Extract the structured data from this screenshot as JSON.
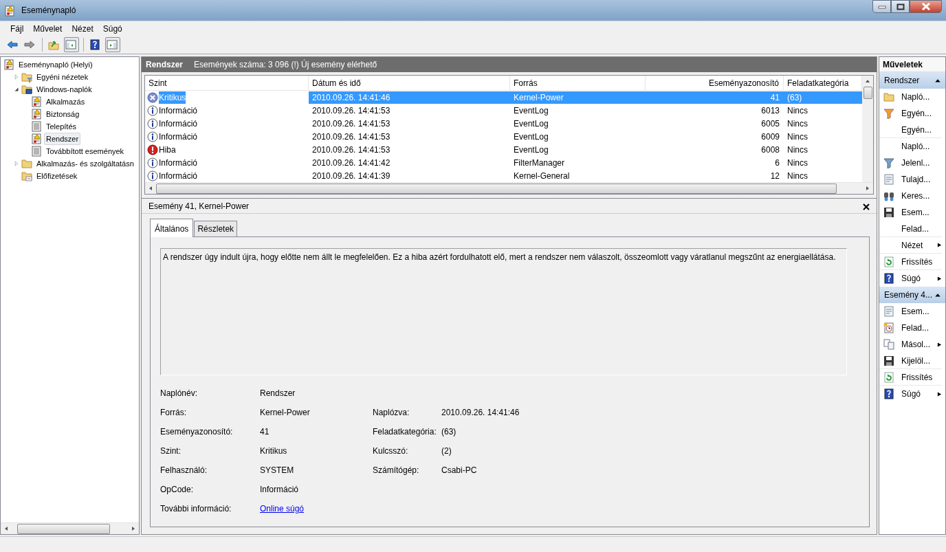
{
  "window": {
    "title": "Eseménynapló"
  },
  "menu": [
    "Fájl",
    "Művelet",
    "Nézet",
    "Súgó"
  ],
  "toolbar": [
    {
      "kind": "back",
      "pressed": false
    },
    {
      "kind": "forward",
      "pressed": false
    },
    {
      "kind": "sep"
    },
    {
      "kind": "up",
      "pressed": false
    },
    {
      "kind": "tree",
      "pressed": true
    },
    {
      "kind": "sep"
    },
    {
      "kind": "help",
      "pressed": false
    },
    {
      "kind": "actions",
      "pressed": true
    }
  ],
  "tree": [
    {
      "label": "Eseménynapló (Helyi)",
      "kind": "log",
      "selected": false,
      "children": [
        {
          "label": "Egyéni nézetek",
          "kind": "folder-filter",
          "expanded": false,
          "selected": false
        },
        {
          "label": "Windows-naplók",
          "kind": "folder-computer",
          "expanded": true,
          "selected": false,
          "children": [
            {
              "label": "Alkalmazás",
              "kind": "log",
              "selected": false
            },
            {
              "label": "Biztonság",
              "kind": "log",
              "selected": false
            },
            {
              "label": "Telepítés",
              "kind": "log-plain",
              "selected": false
            },
            {
              "label": "Rendszer",
              "kind": "log",
              "selected": true
            },
            {
              "label": "Továbbított események",
              "kind": "log-plain",
              "selected": false
            }
          ]
        },
        {
          "label": "Alkalmazás- és szolgáltatásn",
          "kind": "folder",
          "expanded": false,
          "selected": false
        },
        {
          "label": "Előfizetések",
          "kind": "folder-sub",
          "selected": false
        }
      ]
    }
  ],
  "list_header": {
    "title": "Rendszer",
    "info": "Események száma: 3 096 (!) Új esemény elérhető"
  },
  "table": {
    "columns": [
      "Szint",
      "Dátum és idő",
      "Forrás",
      "Eseményazonosító",
      "Feladatkategória"
    ],
    "rows": [
      {
        "kind": "critical",
        "level": "Kritikus",
        "date": "2010.09.26. 14:41:46",
        "source": "Kernel-Power",
        "id": "41",
        "category": "(63)",
        "selected": true
      },
      {
        "kind": "info",
        "level": "Információ",
        "date": "2010.09.26. 14:41:53",
        "source": "EventLog",
        "id": "6013",
        "category": "Nincs",
        "selected": false
      },
      {
        "kind": "info",
        "level": "Információ",
        "date": "2010.09.26. 14:41:53",
        "source": "EventLog",
        "id": "6005",
        "category": "Nincs",
        "selected": false
      },
      {
        "kind": "info",
        "level": "Információ",
        "date": "2010.09.26. 14:41:53",
        "source": "EventLog",
        "id": "6009",
        "category": "Nincs",
        "selected": false
      },
      {
        "kind": "error",
        "level": "Hiba",
        "date": "2010.09.26. 14:41:53",
        "source": "EventLog",
        "id": "6008",
        "category": "Nincs",
        "selected": false
      },
      {
        "kind": "info",
        "level": "Információ",
        "date": "2010.09.26. 14:41:42",
        "source": "FilterManager",
        "id": "6",
        "category": "Nincs",
        "selected": false
      },
      {
        "kind": "info",
        "level": "Információ",
        "date": "2010.09.26. 14:41:39",
        "source": "Kernel-General",
        "id": "12",
        "category": "Nincs",
        "selected": false
      }
    ]
  },
  "details": {
    "title": "Esemény 41, Kernel-Power",
    "tabs": [
      {
        "label": "Általános",
        "selected": true
      },
      {
        "label": "Részletek",
        "selected": false
      }
    ],
    "description": "A rendszer úgy indult újra, hogy előtte nem állt le megfelelően. Ez a hiba azért fordulhatott elő, mert a rendszer nem válaszolt, összeomlott vagy váratlanul megszűnt az energiaellátása.",
    "fields": [
      [
        {
          "label": "Naplónév:",
          "value": "Rendszer"
        }
      ],
      [
        {
          "label": "Forrás:",
          "value": "Kernel-Power"
        },
        {
          "label": "Naplózva:",
          "value": "2010.09.26. 14:41:46"
        }
      ],
      [
        {
          "label": "Eseményazonosító:",
          "value": "41"
        },
        {
          "label": "Feladatkategória:",
          "value": "(63)"
        }
      ],
      [
        {
          "label": "Szint:",
          "value": "Kritikus"
        },
        {
          "label": "Kulcsszó:",
          "value": "(2)"
        }
      ],
      [
        {
          "label": "Felhasználó:",
          "value": "SYSTEM"
        },
        {
          "label": "Számítógép:",
          "value": "Csabi-PC"
        }
      ],
      [
        {
          "label": "OpCode:",
          "value": "Információ"
        }
      ],
      [
        {
          "label": "További információ:",
          "value": "Online súgó",
          "kind": "link"
        }
      ]
    ]
  },
  "actions": {
    "title": "Műveletek",
    "sections": [
      {
        "title": "Rendszer",
        "expanded": true,
        "items": [
          {
            "label": "Napló...",
            "kind": "folder",
            "submenu": false,
            "separator_after": false
          },
          {
            "label": "Egyén...",
            "kind": "filter-gold",
            "submenu": false,
            "separator_after": false
          },
          {
            "label": "Egyén...",
            "kind": "none",
            "submenu": false,
            "separator_after": true
          },
          {
            "label": "Napló...",
            "kind": "none",
            "submenu": false,
            "separator_after": false
          },
          {
            "label": "Jelenl...",
            "kind": "filter",
            "submenu": false,
            "separator_after": false
          },
          {
            "label": "Tulajd...",
            "kind": "properties",
            "submenu": false,
            "separator_after": false
          },
          {
            "label": "Keres...",
            "kind": "binoculars",
            "submenu": false,
            "separator_after": false
          },
          {
            "label": "Esem...",
            "kind": "save",
            "submenu": false,
            "separator_after": false
          },
          {
            "label": "Felad...",
            "kind": "none",
            "submenu": false,
            "separator_after": true
          },
          {
            "label": "Nézet",
            "kind": "none",
            "submenu": true,
            "separator_after": true
          },
          {
            "label": "Frissítés",
            "kind": "refresh",
            "submenu": false,
            "separator_after": true
          },
          {
            "label": "Súgó",
            "kind": "help",
            "submenu": true,
            "separator_after": false
          }
        ]
      },
      {
        "title": "Esemény 4...",
        "expanded": true,
        "items": [
          {
            "label": "Esem...",
            "kind": "properties",
            "submenu": false,
            "separator_after": false
          },
          {
            "label": "Felad...",
            "kind": "clock",
            "submenu": false,
            "separator_after": false
          },
          {
            "label": "Másol...",
            "kind": "copy",
            "submenu": true,
            "separator_after": false
          },
          {
            "label": "Kijelöl...",
            "kind": "save",
            "submenu": false,
            "separator_after": true
          },
          {
            "label": "Frissítés",
            "kind": "refresh",
            "submenu": false,
            "separator_after": true
          },
          {
            "label": "Súgó",
            "kind": "help",
            "submenu": true,
            "separator_after": false
          }
        ]
      }
    ]
  }
}
